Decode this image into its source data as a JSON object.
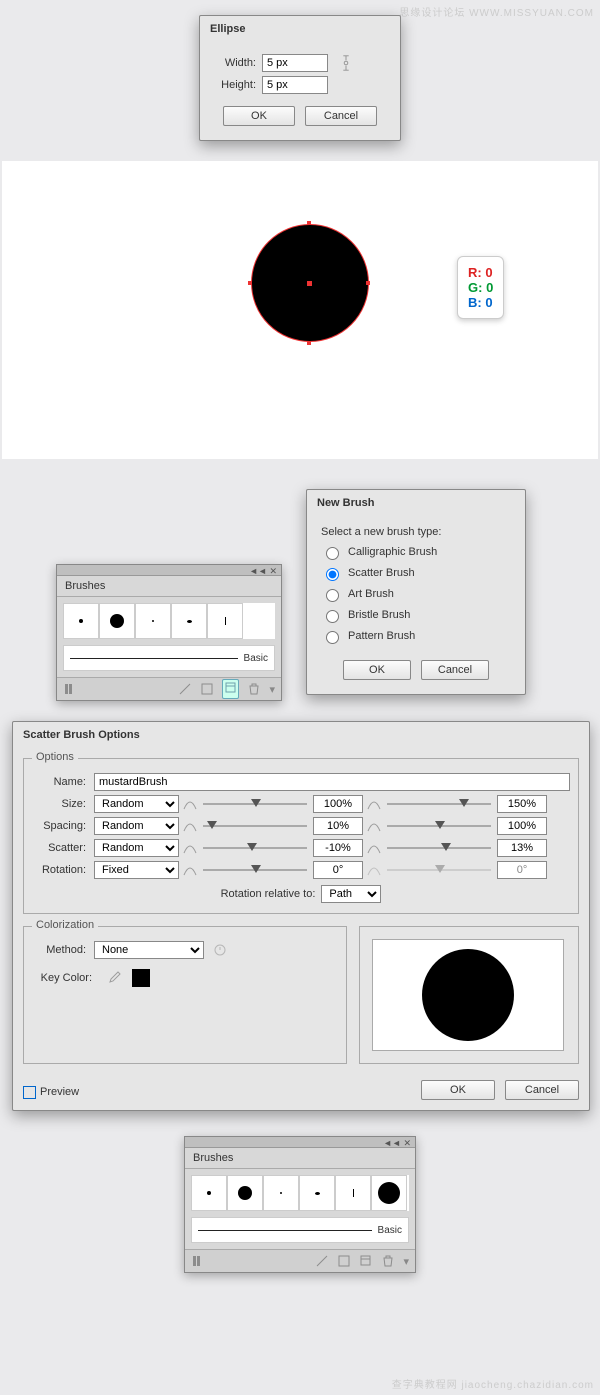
{
  "watermarks": {
    "top": "思缘设计论坛  WWW.MISSYUAN.COM",
    "bottom": "查字典教程网  jiaocheng.chazidian.com"
  },
  "ellipse": {
    "title": "Ellipse",
    "width_label": "Width:",
    "width_value": "5 px",
    "height_label": "Height:",
    "height_value": "5 px",
    "ok": "OK",
    "cancel": "Cancel"
  },
  "rgb": {
    "r_label": "R:",
    "r": "0",
    "g_label": "G:",
    "g": "0",
    "b_label": "B:",
    "b": "0"
  },
  "brushes_panel": {
    "title": "Brushes",
    "basic": "Basic"
  },
  "new_brush": {
    "title": "New Brush",
    "prompt": "Select a new brush type:",
    "options": [
      "Calligraphic Brush",
      "Scatter Brush",
      "Art Brush",
      "Bristle Brush",
      "Pattern Brush"
    ],
    "selected": 1,
    "ok": "OK",
    "cancel": "Cancel"
  },
  "scatter": {
    "title": "Scatter Brush Options",
    "options_legend": "Options",
    "name_label": "Name:",
    "name_value": "mustardBrush",
    "rows": {
      "size": {
        "label": "Size:",
        "mode": "Random",
        "v1": "100%",
        "v2": "150%"
      },
      "spacing": {
        "label": "Spacing:",
        "mode": "Random",
        "v1": "10%",
        "v2": "100%"
      },
      "scatter": {
        "label": "Scatter:",
        "mode": "Random",
        "v1": "-10%",
        "v2": "13%"
      },
      "rotation": {
        "label": "Rotation:",
        "mode": "Fixed",
        "v1": "0°",
        "v2": "0°"
      }
    },
    "rotation_rel_label": "Rotation relative to:",
    "rotation_rel_value": "Path",
    "colorization_legend": "Colorization",
    "method_label": "Method:",
    "method_value": "None",
    "keycolor_label": "Key Color:",
    "preview_label": "Preview",
    "ok": "OK",
    "cancel": "Cancel"
  }
}
